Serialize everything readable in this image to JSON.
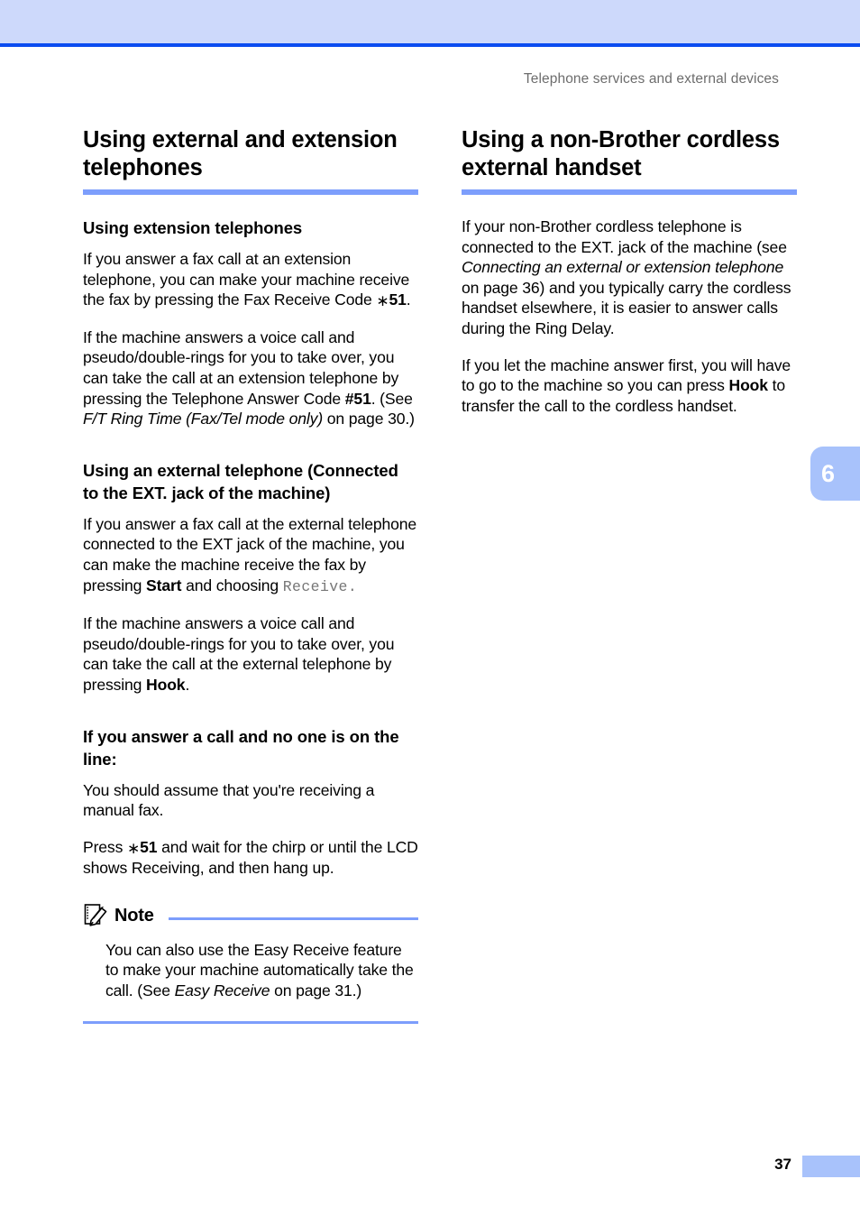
{
  "header": {
    "running_head": "Telephone services and external devices"
  },
  "colors": {
    "band": "#cdd9fb",
    "rule": "#0b4cf0",
    "accent": "#7d9efc",
    "tab": "#a8c2fb"
  },
  "chapter_tab": {
    "number": "6"
  },
  "footer": {
    "page_number": "37"
  },
  "left_column": {
    "section_title": "Using external and extension telephones",
    "sub1": {
      "heading": "Using extension telephones",
      "para1_a": "If you answer a fax call at an extension telephone, you can make your machine receive the fax by pressing the Fax Receive Code ",
      "para1_ast": "∗",
      "para1_bold": "51",
      "para1_b": ".",
      "para2_a": "If the machine answers a voice call and pseudo/double-rings for you to take over, you can take the call at an extension telephone by pressing the Telephone Answer Code ",
      "para2_bold": "#51",
      "para2_b": ". (See ",
      "para2_italic": "F/T Ring Time (Fax/Tel mode only)",
      "para2_c": " on page 30.)"
    },
    "sub2": {
      "heading": "Using an external telephone (Connected to the EXT. jack of the machine)",
      "para1_a": "If you answer a fax call at the external telephone connected to the EXT jack of the machine, you can make the machine receive the fax by pressing ",
      "para1_bold": "Start",
      "para1_b": " and choosing ",
      "para1_mono": "Receive.",
      "para2_a": "If the machine answers a voice call and pseudo/double-rings for you to take over, you can take the call at the external telephone by pressing ",
      "para2_bold": "Hook",
      "para2_b": "."
    },
    "sub3": {
      "heading": "If you answer a call and no one is on the line:",
      "para1": "You should assume that you're receiving a manual fax.",
      "para2_a": "Press ",
      "para2_ast": "∗",
      "para2_bold": "51",
      "para2_b": " and wait for the chirp or until the LCD shows Receiving, and then hang up."
    },
    "note": {
      "label": "Note",
      "icon_name": "note-pencil-icon",
      "para_a": "You can also use the Easy Receive feature to make your machine automatically take the call. (See ",
      "para_italic": "Easy Receive",
      "para_b": " on page 31.)"
    }
  },
  "right_column": {
    "section_title": "Using a non-Brother cordless external handset",
    "para1_a": "If your non-Brother cordless telephone is connected to the EXT. jack of the machine (see ",
    "para1_italic": "Connecting an external or extension telephone",
    "para1_b": " on page 36) and you typically carry the cordless handset elsewhere, it is easier to answer calls during the Ring Delay.",
    "para2_a": "If you let the machine answer first, you will have to go to the machine so you can press ",
    "para2_bold": "Hook",
    "para2_b": " to transfer the call to the cordless handset."
  }
}
